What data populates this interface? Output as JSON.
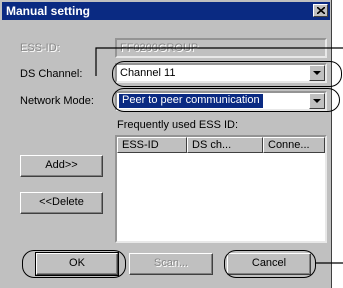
{
  "window": {
    "title": "Manual setting"
  },
  "essid": {
    "label": "ESS-ID:",
    "value": "FF0200GROUP"
  },
  "ds_channel": {
    "label": "DS Channel:",
    "value": "Channel 11"
  },
  "network_mode": {
    "label": "Network Mode:",
    "value": "Peer to peer communication"
  },
  "frequent": {
    "label": "Frequently used ESS ID:",
    "columns": [
      "ESS-ID",
      "DS ch...",
      "Conne..."
    ]
  },
  "buttons": {
    "add": "Add>>",
    "delete": "<<Delete",
    "ok": "OK",
    "scan": "Scan...",
    "cancel": "Cancel"
  },
  "colors": {
    "title_bar": "#0a2a82",
    "dialog_face": "#c0c0c0",
    "selection": "#0a2a82"
  },
  "icons": {
    "close": "close-icon",
    "dropdown": "chevron-down-icon"
  }
}
